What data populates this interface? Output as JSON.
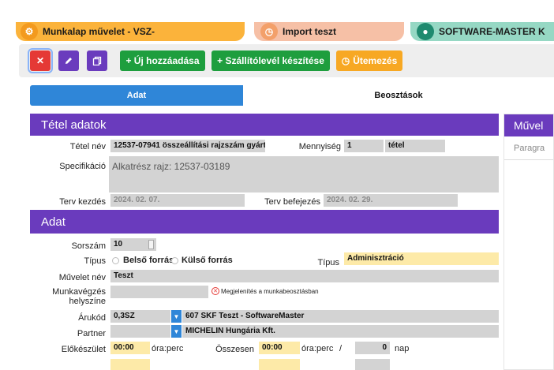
{
  "open_tabs": [
    {
      "label": "Munkalap művelet - VSZ-",
      "icon": "gear-icon"
    },
    {
      "label": "Import teszt",
      "icon": "clock-icon"
    },
    {
      "label": "SOFTWARE-MASTER K",
      "icon": "user-icon"
    }
  ],
  "toolbar": {
    "close_icon": "✕",
    "edit_icon": "pencil-icon",
    "copy_icon": "copy-icon",
    "add_label": "+ Új hozzáadása",
    "delivery_label": "+ Szállítólevél készítése",
    "schedule_label": "Ütemezés"
  },
  "segments": {
    "data_label": "Adat",
    "assign_label": "Beosztások"
  },
  "item_section": {
    "title": "Tétel adatok",
    "name_label": "Tétel név",
    "name_value": "12537-07941 összeállítási rajzszám gyárt",
    "qty_label": "Mennyiség",
    "qty_value": "1",
    "qty_unit": "tétel",
    "spec_label": "Specifikáció",
    "spec_value": "Alkatrész rajz: 12537-03189",
    "start_label": "Terv kezdés",
    "start_value": "2024. 02. 07.",
    "end_label": "Terv befejezés",
    "end_value": "2024. 02. 29."
  },
  "data_section": {
    "title": "Adat",
    "seq_label": "Sorszám",
    "seq_value": "10",
    "type_label": "Típus",
    "type_option_internal": "Belső forrás",
    "type_option_external": "Külső forrás",
    "type2_label": "Típus",
    "type2_value": "Adminisztráció",
    "op_name_label": "Művelet név",
    "op_name_value": "Teszt",
    "workplace_label_1": "Munkavégzés",
    "workplace_label_2": "helyszíne",
    "workplace_note": "Megjelenítés a munkabeosztásban",
    "product_label": "Árukód",
    "product_code": "0,3SZ",
    "product_value": "607 SKF Teszt - SoftwareMaster",
    "partner_label": "Partner",
    "partner_value": "MICHELIN Hungária Kft.",
    "prep_label": "Előkészület",
    "prep_value": "00:00",
    "prep_unit": "óra:perc",
    "total_label": "Összesen",
    "total_value": "00:00",
    "total_unit": "óra:perc",
    "slash": "/",
    "days_value": "0",
    "days_unit": "nap"
  },
  "right_panel": {
    "title": "Művel",
    "placeholder": "Paragra"
  },
  "colors": {
    "purple": "#6a3bbd",
    "blue": "#2f86d8",
    "green": "#1e9e3e",
    "orange": "#f7a823",
    "red": "#e53935"
  }
}
